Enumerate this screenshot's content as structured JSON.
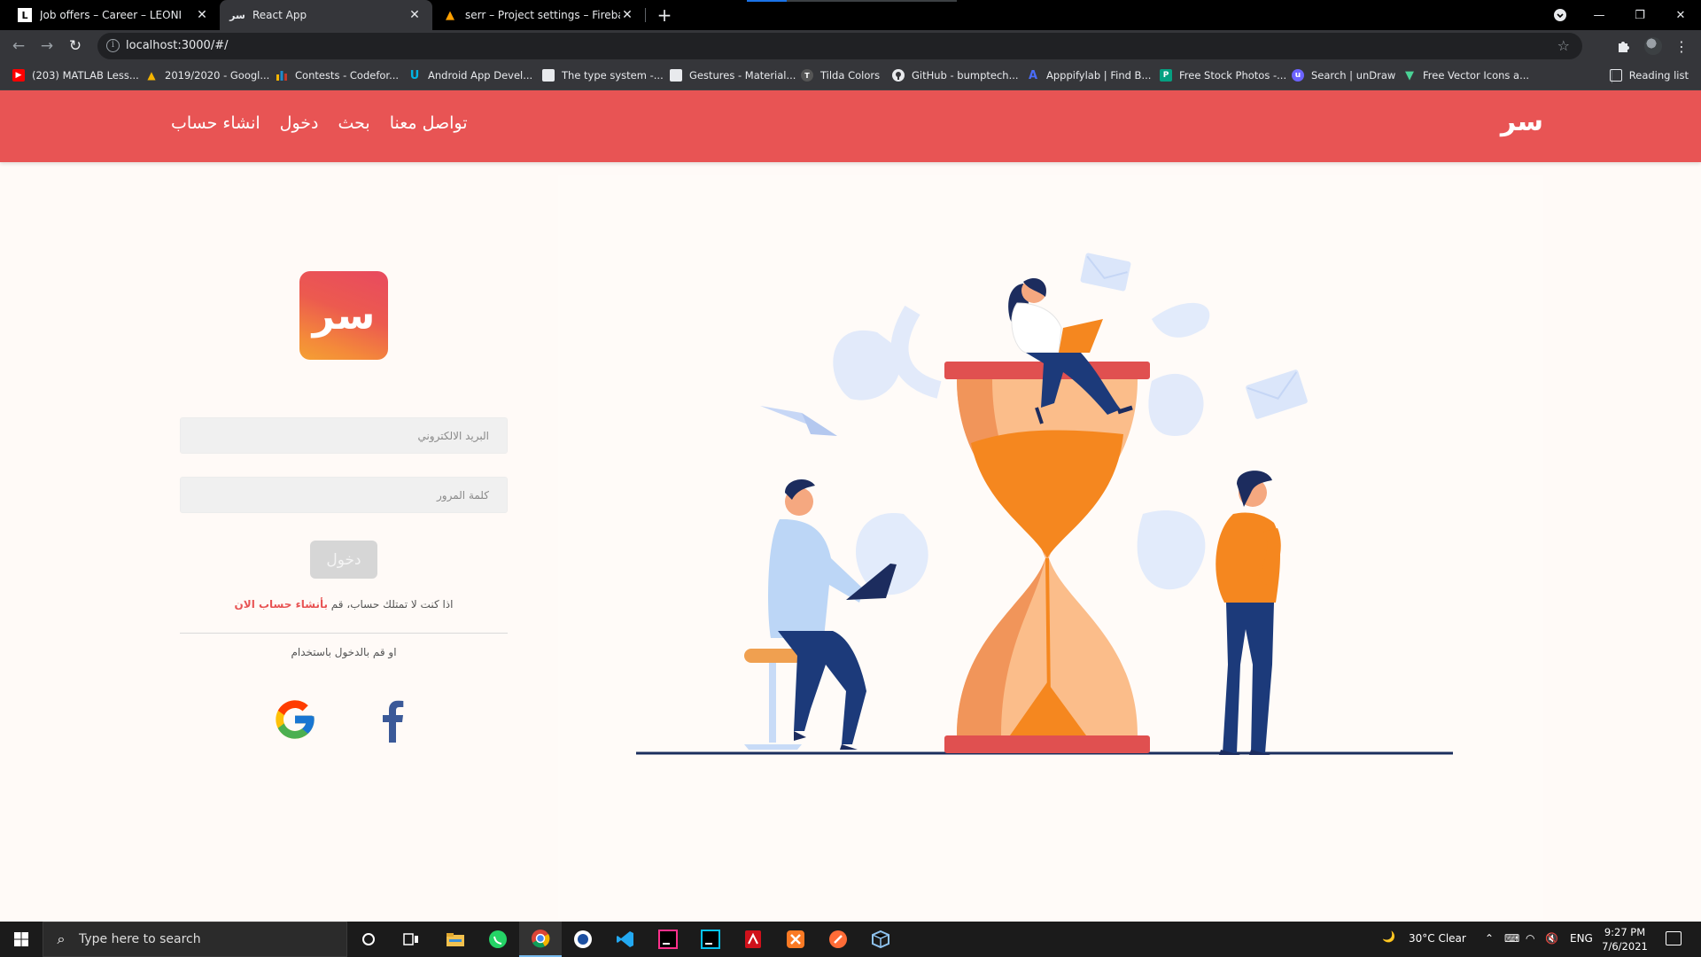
{
  "browser": {
    "tabs": [
      {
        "title": "Job offers – Career – LEONI",
        "favicon": "leoni-icon"
      },
      {
        "title": "React App",
        "favicon": "react-app-icon"
      },
      {
        "title": "serr – Project settings – Firebase",
        "favicon": "firebase-icon"
      }
    ],
    "active_tab": 1,
    "address": "localhost:3000/#/",
    "bookmarks": [
      {
        "label": "(203) MATLAB Less...",
        "icon": "youtube-icon",
        "color": "#ff0000"
      },
      {
        "label": "2019/2020 - Googl...",
        "icon": "google-drive-icon",
        "color": "#f4b400"
      },
      {
        "label": "Contests - Codefor...",
        "icon": "codeforces-icon",
        "color": "#1f8acb"
      },
      {
        "label": "Android App Devel...",
        "icon": "udacity-icon",
        "color": "#02b3e4"
      },
      {
        "label": "The type system -...",
        "icon": "page-icon",
        "color": "#e8eaed"
      },
      {
        "label": "Gestures - Material...",
        "icon": "page-icon",
        "color": "#e8eaed"
      },
      {
        "label": "Tilda Colors",
        "icon": "tilda-icon",
        "color": "#555555"
      },
      {
        "label": "GitHub - bumptech...",
        "icon": "github-icon",
        "color": "#e8eaed"
      },
      {
        "label": "Apppifylab | Find B...",
        "icon": "appifylab-icon",
        "color": "#4a6cf7"
      },
      {
        "label": "Free Stock Photos -...",
        "icon": "pexels-icon",
        "color": "#05a081"
      },
      {
        "label": "Search | unDraw",
        "icon": "undraw-icon",
        "color": "#6c63ff"
      },
      {
        "label": "Free Vector Icons a...",
        "icon": "flaticon-icon",
        "color": "#4ad295"
      }
    ],
    "reading_list": "Reading list"
  },
  "app": {
    "brand": "سر",
    "nav": [
      "انشاء حساب",
      "دخول",
      "بحث",
      "تواصل معنا"
    ],
    "logo_text": "سر",
    "email_placeholder": "البريد الالكتروني",
    "password_placeholder": "كلمة المرور",
    "login_button": "دخول",
    "signup_prompt": "اذا كنت لا تمتلك حساب، قم ",
    "signup_link": "بأنشاء حساب الان",
    "or_text": "او قم بالدخول باستخدام",
    "social": [
      "google-icon",
      "facebook-icon"
    ],
    "colors": {
      "primary": "#e85454",
      "accent_orange": "#f5871f",
      "navy": "#1c3a7a"
    }
  },
  "taskbar": {
    "search_placeholder": "Type here to search",
    "weather": "30°C  Clear",
    "language": "ENG",
    "time": "9:27 PM",
    "date": "7/6/2021"
  }
}
